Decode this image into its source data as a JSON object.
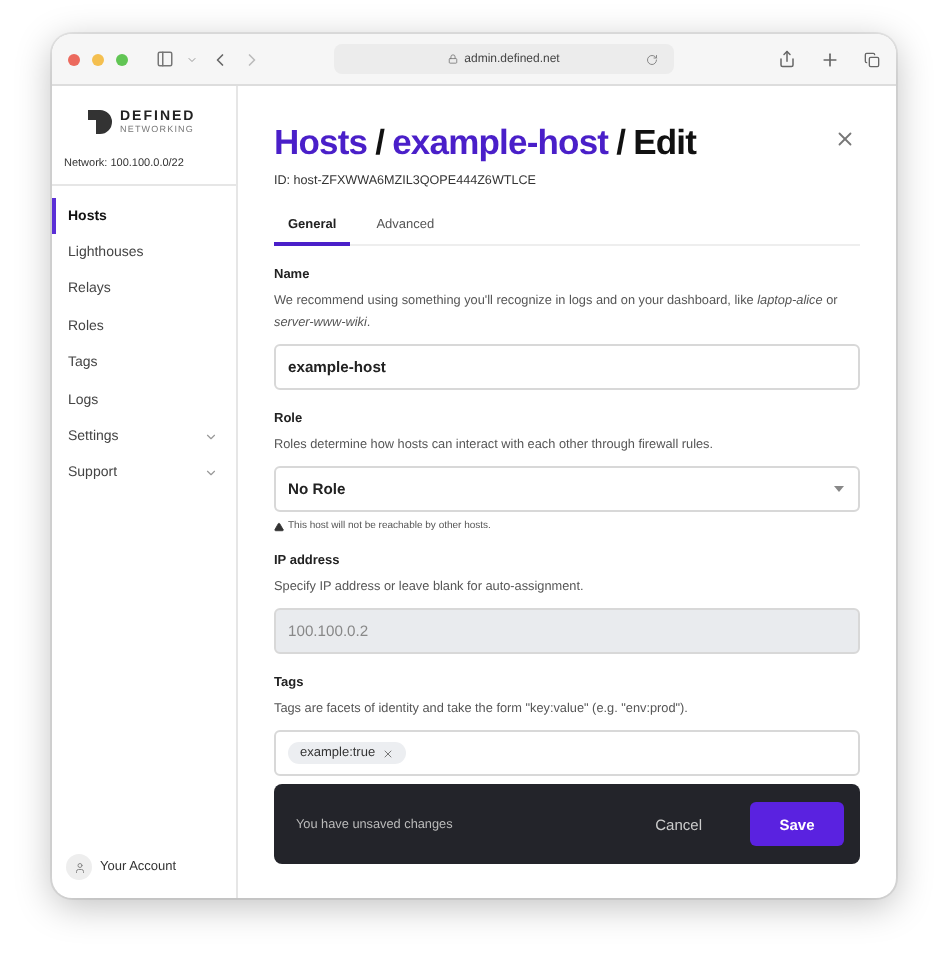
{
  "browser": {
    "url": "admin.defined.net"
  },
  "sidebar": {
    "logo": {
      "name": "DEFINED",
      "subtitle": "NETWORKING"
    },
    "network": "Network: 100.100.0.0/22",
    "items": [
      {
        "label": "Hosts",
        "selected": true,
        "expandable": false
      },
      {
        "label": "Lighthouses",
        "selected": false,
        "expandable": false
      },
      {
        "label": "Relays",
        "selected": false,
        "expandable": false
      },
      {
        "label": "Roles",
        "selected": false,
        "expandable": false
      },
      {
        "label": "Tags",
        "selected": false,
        "expandable": false
      },
      {
        "label": "Logs",
        "selected": false,
        "expandable": false
      },
      {
        "label": "Settings",
        "selected": false,
        "expandable": true
      },
      {
        "label": "Support",
        "selected": false,
        "expandable": true
      }
    ],
    "account": "Your Account"
  },
  "header": {
    "breadcrumbs": [
      "Hosts",
      "example-host",
      "Edit"
    ],
    "separator": "/",
    "id": "ID: host-ZFXWWA6MZIL3QOPE444Z6WTLCE"
  },
  "tabs": [
    {
      "label": "General",
      "selected": true
    },
    {
      "label": "Advanced",
      "selected": false
    }
  ],
  "fields": [
    {
      "kind": "text",
      "label": "Name",
      "description": "We recommend using something you'll recognize in logs and on your dashboard, like *laptop-alice* or *server-www-wiki*.",
      "value": "example-host",
      "disabled": false
    },
    {
      "kind": "select",
      "label": "Role",
      "description": "Roles determine how hosts can interact with each other through firewall rules.",
      "value": "No Role",
      "warning": "This host will not be reachable by other hosts."
    },
    {
      "kind": "text",
      "label": "IP address",
      "description": "Specify IP address or leave blank for auto-assignment.",
      "value": "100.100.0.2",
      "disabled": true
    },
    {
      "kind": "tags",
      "label": "Tags",
      "description": "Tags are facets of identity and take the form \"key:value\" (e.g. \"env:prod\").",
      "tags": [
        "example:true"
      ]
    }
  ],
  "footer": {
    "message": "You have unsaved changes",
    "cancel": "Cancel",
    "save": "Save"
  }
}
